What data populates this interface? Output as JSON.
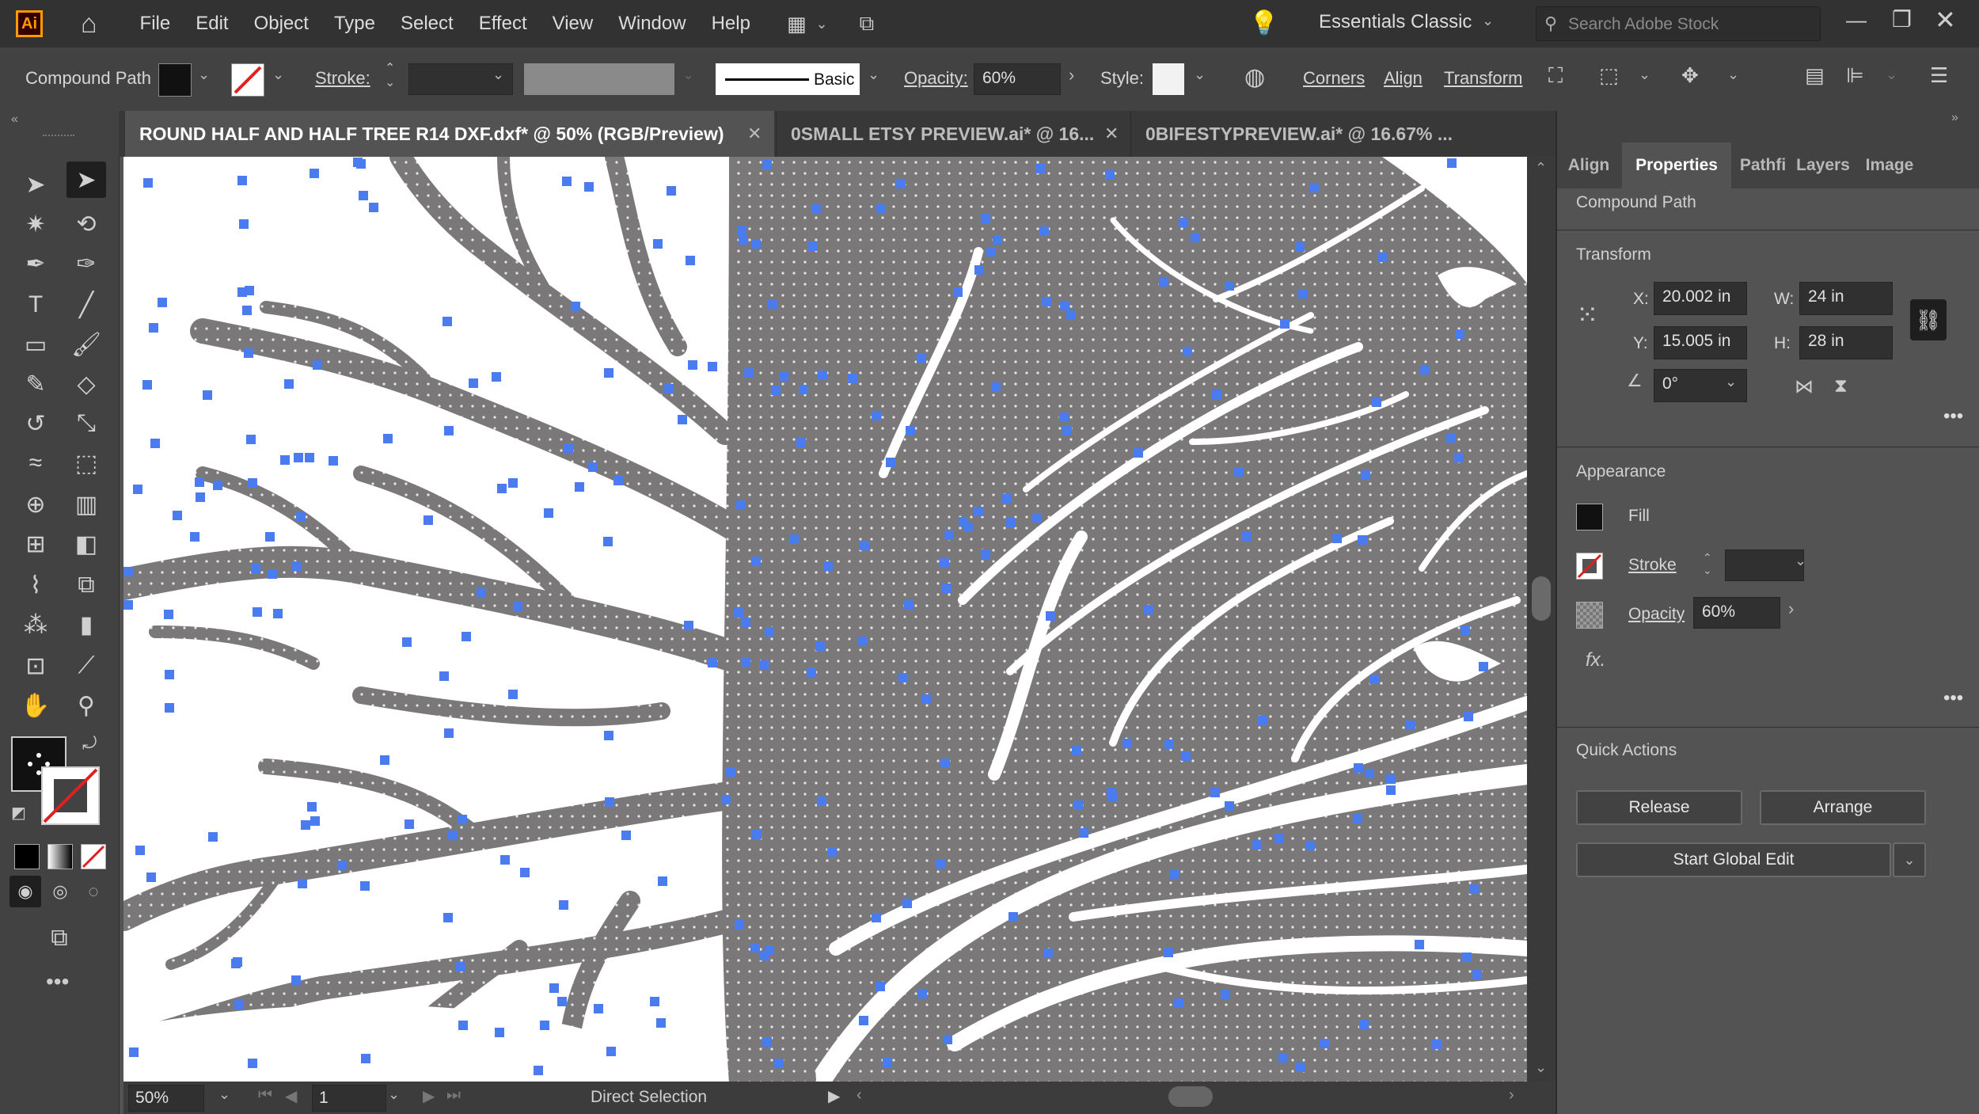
{
  "app": {
    "logo": "Ai"
  },
  "menu": [
    "File",
    "Edit",
    "Object",
    "Type",
    "Select",
    "Effect",
    "View",
    "Window",
    "Help"
  ],
  "workspace": "Essentials Classic",
  "search": {
    "placeholder": "Search Adobe Stock"
  },
  "control": {
    "object_type": "Compound Path",
    "stroke_label": "Stroke:",
    "stroke_profile": "Basic",
    "opacity_label": "Opacity:",
    "opacity_value": "60%",
    "style_label": "Style:",
    "corners": "Corners",
    "align": "Align",
    "transform": "Transform"
  },
  "tabs": [
    {
      "title": "ROUND HALF AND HALF TREE R14 DXF.dxf* @ 50% (RGB/Preview)",
      "active": true
    },
    {
      "title": "0SMALL ETSY PREVIEW.ai* @ 16...",
      "active": false
    },
    {
      "title": "0BIFESTYPREVIEW.ai* @ 16.67% ...",
      "active": false
    }
  ],
  "panel": {
    "tabs": [
      "Align",
      "Properties",
      "Pathfi",
      "Layers",
      "Image"
    ],
    "active_tab": "Properties",
    "object_type": "Compound Path",
    "transform": {
      "title": "Transform",
      "x_label": "X:",
      "x": "20.002 in",
      "y_label": "Y:",
      "y": "15.005 in",
      "w_label": "W:",
      "w": "24 in",
      "h_label": "H:",
      "h": "28 in",
      "angle": "0°"
    },
    "appearance": {
      "title": "Appearance",
      "fill": "Fill",
      "stroke": "Stroke",
      "opacity_label": "Opacity",
      "opacity_value": "60%",
      "fx": "fx."
    },
    "quick_actions": {
      "title": "Quick Actions",
      "release": "Release",
      "arrange": "Arrange",
      "start_global_edit": "Start Global Edit"
    }
  },
  "status": {
    "zoom": "50%",
    "artboard": "1",
    "tool": "Direct Selection"
  },
  "colors": {
    "selection": "#4a7cf0",
    "art_fill": "#7a7878",
    "accent": "#ff9a00"
  }
}
